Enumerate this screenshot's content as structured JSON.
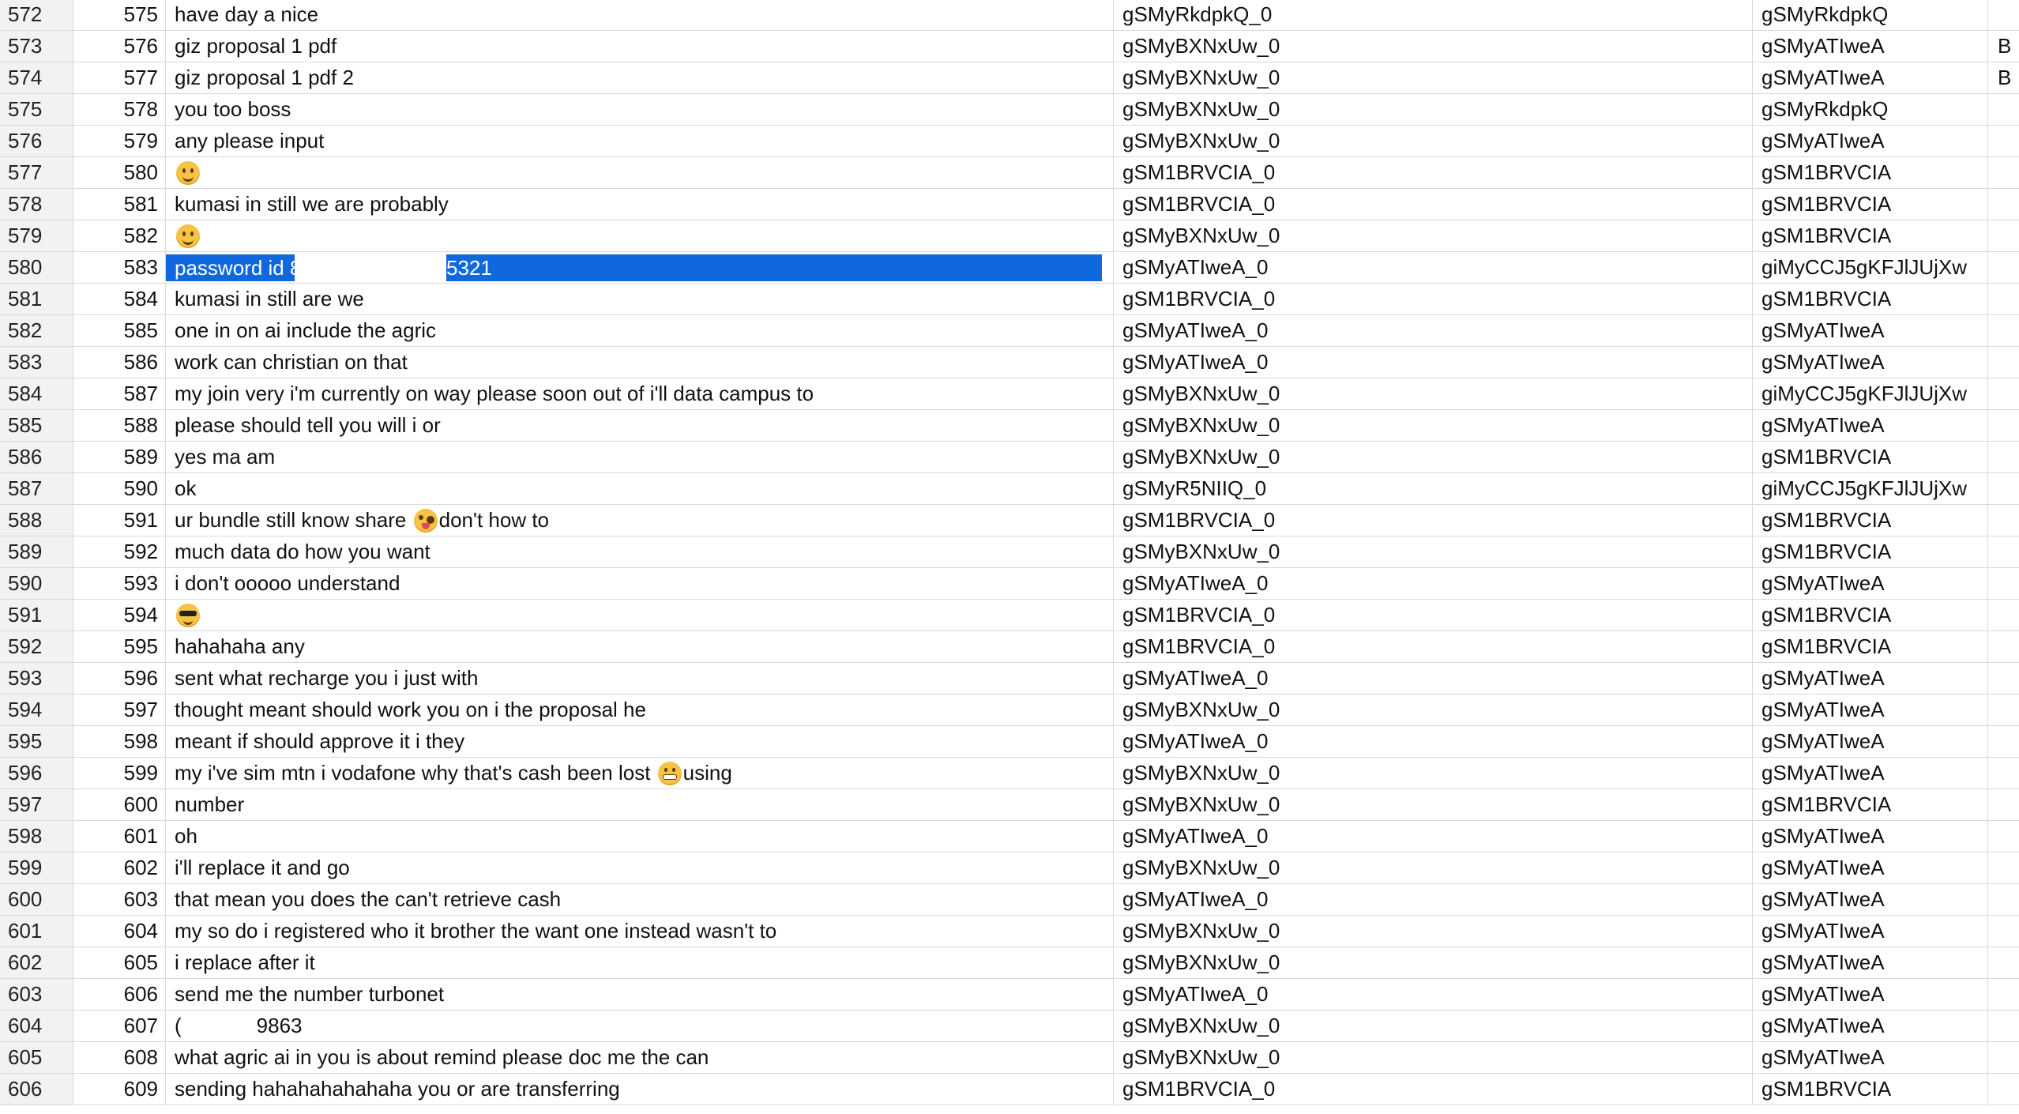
{
  "rows": [
    {
      "rownum": "572",
      "idx": "575",
      "text": "have day a nice",
      "sender": "gSMyRkdpkQ_0",
      "recv": "gSMyRkdpkQ",
      "extra": ""
    },
    {
      "rownum": "573",
      "idx": "576",
      "text": "giz proposal 1 pdf",
      "sender": "gSMyBXNxUw_0",
      "recv": "gSMyATIweA",
      "extra": "B"
    },
    {
      "rownum": "574",
      "idx": "577",
      "text": "giz proposal 1 pdf 2",
      "sender": "gSMyBXNxUw_0",
      "recv": "gSMyATIweA",
      "extra": "B"
    },
    {
      "rownum": "575",
      "idx": "578",
      "text": "you too boss",
      "sender": "gSMyBXNxUw_0",
      "recv": "gSMyRkdpkQ",
      "extra": ""
    },
    {
      "rownum": "576",
      "idx": "579",
      "text": "any please input",
      "sender": "gSMyBXNxUw_0",
      "recv": "gSMyATIweA",
      "extra": ""
    },
    {
      "rownum": "577",
      "idx": "580",
      "text": "",
      "emoji": "smile-icon",
      "sender": "gSM1BRVCIA_0",
      "recv": "gSM1BRVCIA",
      "extra": ""
    },
    {
      "rownum": "578",
      "idx": "581",
      "text": "kumasi in still we are probably",
      "sender": "gSM1BRVCIA_0",
      "recv": "gSM1BRVCIA",
      "extra": ""
    },
    {
      "rownum": "579",
      "idx": "582",
      "text": "",
      "emoji": "smile-icon",
      "sender": "gSMyBXNxUw_0",
      "recv": "gSM1BRVCIA",
      "extra": ""
    },
    {
      "rownum": "580",
      "idx": "583",
      "text_lead": "password id 8",
      "text_tail": "5321",
      "selected": true,
      "sender": "gSMyATIweA_0",
      "recv": "giMyCCJ5gKFJlJUjXw",
      "extra": ""
    },
    {
      "rownum": "581",
      "idx": "584",
      "text": "kumasi in still are we",
      "sender": "gSM1BRVCIA_0",
      "recv": "gSM1BRVCIA",
      "extra": ""
    },
    {
      "rownum": "582",
      "idx": "585",
      "text": "one in on ai include the agric",
      "sender": "gSMyATIweA_0",
      "recv": "gSMyATIweA",
      "extra": ""
    },
    {
      "rownum": "583",
      "idx": "586",
      "text": "work can christian on that",
      "sender": "gSMyATIweA_0",
      "recv": "gSMyATIweA",
      "extra": ""
    },
    {
      "rownum": "584",
      "idx": "587",
      "text": "my join very i'm currently on way please soon out of i'll data campus to",
      "sender": "gSMyBXNxUw_0",
      "recv": "giMyCCJ5gKFJlJUjXw",
      "extra": ""
    },
    {
      "rownum": "585",
      "idx": "588",
      "text": "please should tell you will i or",
      "sender": "gSMyBXNxUw_0",
      "recv": "gSMyATIweA",
      "extra": ""
    },
    {
      "rownum": "586",
      "idx": "589",
      "text": "yes ma am",
      "sender": "gSMyBXNxUw_0",
      "recv": "gSM1BRVCIA",
      "extra": ""
    },
    {
      "rownum": "587",
      "idx": "590",
      "text": "ok",
      "sender": "gSMyR5NIIQ_0",
      "recv": "giMyCCJ5gKFJlJUjXw",
      "extra": ""
    },
    {
      "rownum": "588",
      "idx": "591",
      "text_before": "ur bundle still know share ",
      "emoji_inline": "zany-icon",
      "text_after": "don't how to",
      "sender": "gSM1BRVCIA_0",
      "recv": "gSM1BRVCIA",
      "extra": ""
    },
    {
      "rownum": "589",
      "idx": "592",
      "text": "much data do how you want",
      "sender": "gSMyBXNxUw_0",
      "recv": "gSM1BRVCIA",
      "extra": ""
    },
    {
      "rownum": "590",
      "idx": "593",
      "text": "i don't ooooo understand",
      "sender": "gSMyATIweA_0",
      "recv": "gSMyATIweA",
      "extra": ""
    },
    {
      "rownum": "591",
      "idx": "594",
      "text": "",
      "emoji": "cool-icon",
      "sender": "gSM1BRVCIA_0",
      "recv": "gSM1BRVCIA",
      "extra": ""
    },
    {
      "rownum": "592",
      "idx": "595",
      "text": "hahahaha any",
      "sender": "gSM1BRVCIA_0",
      "recv": "gSM1BRVCIA",
      "extra": ""
    },
    {
      "rownum": "593",
      "idx": "596",
      "text": "sent what recharge you i just with",
      "sender": "gSMyATIweA_0",
      "recv": "gSMyATIweA",
      "extra": ""
    },
    {
      "rownum": "594",
      "idx": "597",
      "text": "thought meant should work you on i the proposal he",
      "sender": "gSMyBXNxUw_0",
      "recv": "gSMyATIweA",
      "extra": ""
    },
    {
      "rownum": "595",
      "idx": "598",
      "text": "meant if should approve it i they",
      "sender": "gSMyATIweA_0",
      "recv": "gSMyATIweA",
      "extra": ""
    },
    {
      "rownum": "596",
      "idx": "599",
      "text_before": "my i've sim mtn i vodafone why that's cash been lost ",
      "emoji_inline": "grimace-icon",
      "text_after": "using",
      "sender": "gSMyBXNxUw_0",
      "recv": "gSMyATIweA",
      "extra": ""
    },
    {
      "rownum": "597",
      "idx": "600",
      "text": "number",
      "sender": "gSMyBXNxUw_0",
      "recv": "gSM1BRVCIA",
      "extra": ""
    },
    {
      "rownum": "598",
      "idx": "601",
      "text": "oh",
      "sender": "gSMyATIweA_0",
      "recv": "gSMyATIweA",
      "extra": ""
    },
    {
      "rownum": "599",
      "idx": "602",
      "text": "i'll replace it and go",
      "sender": "gSMyBXNxUw_0",
      "recv": "gSMyATIweA",
      "extra": ""
    },
    {
      "rownum": "600",
      "idx": "603",
      "text": "that mean you does the can't retrieve cash",
      "sender": "gSMyATIweA_0",
      "recv": "gSMyATIweA",
      "extra": ""
    },
    {
      "rownum": "601",
      "idx": "604",
      "text": "my so do i registered who it brother the want one instead wasn't to",
      "sender": "gSMyBXNxUw_0",
      "recv": "gSMyATIweA",
      "extra": ""
    },
    {
      "rownum": "602",
      "idx": "605",
      "text": "i replace after it",
      "sender": "gSMyBXNxUw_0",
      "recv": "gSMyATIweA",
      "extra": ""
    },
    {
      "rownum": "603",
      "idx": "606",
      "text": "send me the number turbonet",
      "sender": "gSMyATIweA_0",
      "recv": "gSMyATIweA",
      "extra": ""
    },
    {
      "rownum": "604",
      "idx": "607",
      "text_before": "(",
      "redacted": true,
      "text_after": "9863",
      "sender": "gSMyBXNxUw_0",
      "recv": "gSMyATIweA",
      "extra": ""
    },
    {
      "rownum": "605",
      "idx": "608",
      "text": "what agric ai in you is about remind please doc me the can",
      "sender": "gSMyBXNxUw_0",
      "recv": "gSMyATIweA",
      "extra": ""
    },
    {
      "rownum": "606",
      "idx": "609",
      "text": "sending hahahahahahaha you or are transferring",
      "sender": "gSM1BRVCIA_0",
      "recv": "gSM1BRVCIA",
      "extra": ""
    }
  ]
}
